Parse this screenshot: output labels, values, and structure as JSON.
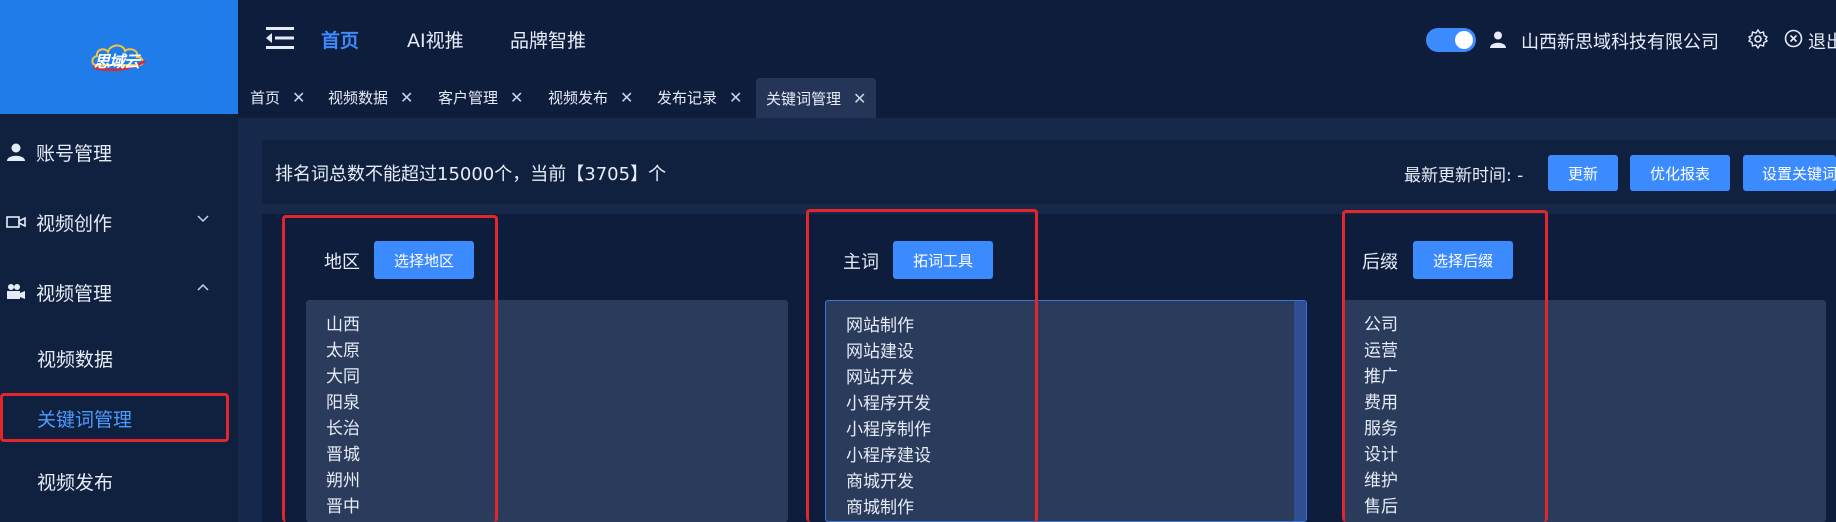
{
  "app": {
    "logo_text": "思域云",
    "brand_color": "#1f7ce8",
    "accent_color": "#3b8bff",
    "highlight_color": "#e3262b"
  },
  "sidebar": {
    "items": [
      {
        "label": "账号管理",
        "icon": "user-icon"
      },
      {
        "label": "视频创作",
        "icon": "video-camera-icon",
        "chevron": "chevron-down-icon"
      },
      {
        "label": "视频管理",
        "icon": "film-camera-icon",
        "chevron": "chevron-up-icon"
      }
    ],
    "subitems": [
      {
        "label": "视频数据"
      },
      {
        "label": "关键词管理",
        "active": true
      },
      {
        "label": "视频发布"
      }
    ]
  },
  "header": {
    "nav": [
      "首页",
      "AI视推",
      "品牌智推"
    ],
    "company": "山西新思域科技有限公司",
    "logout": "退出"
  },
  "tabs": [
    {
      "label": "首页"
    },
    {
      "label": "视频数据"
    },
    {
      "label": "客户管理"
    },
    {
      "label": "视频发布"
    },
    {
      "label": "发布记录"
    },
    {
      "label": "关键词管理",
      "active": true
    }
  ],
  "infobar": {
    "text": "排名词总数不能超过15000个，当前【3705】个",
    "update_label": "最新更新时间: -",
    "buttons": [
      "更新",
      "优化报表",
      "设置关键词"
    ]
  },
  "columns": [
    {
      "label": "地区",
      "button": "选择地区",
      "items": [
        "山西",
        "太原",
        "大同",
        "阳泉",
        "长治",
        "晋城",
        "朔州",
        "晋中"
      ]
    },
    {
      "label": "主词",
      "button": "拓词工具",
      "items": [
        "网站制作",
        "网站建设",
        "网站开发",
        "小程序开发",
        "小程序制作",
        "小程序建设",
        "商城开发",
        "商城制作"
      ]
    },
    {
      "label": "后缀",
      "button": "选择后缀",
      "items": [
        "公司",
        "运营",
        "推广",
        "费用",
        "服务",
        "设计",
        "维护",
        "售后"
      ]
    }
  ]
}
